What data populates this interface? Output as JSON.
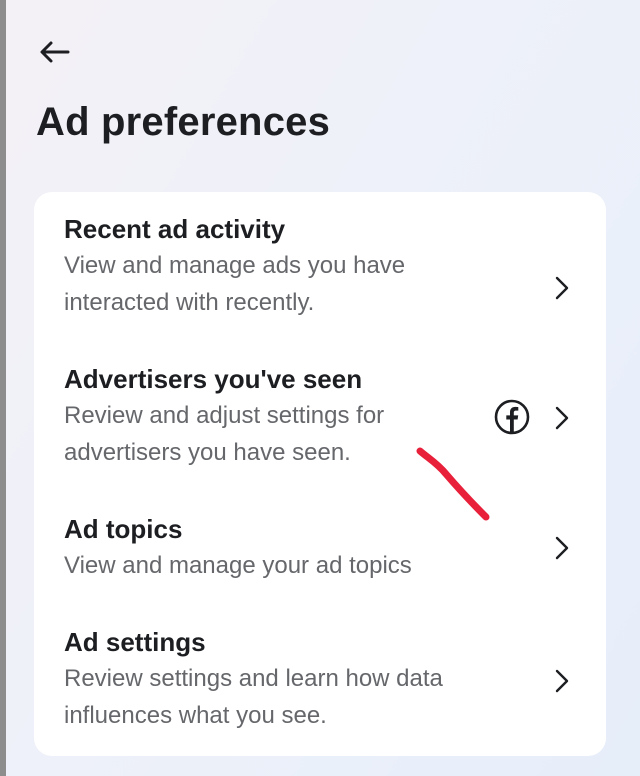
{
  "header": {
    "back_icon": "arrow-left-icon",
    "title": "Ad preferences"
  },
  "menu": {
    "items": [
      {
        "title": "Recent ad activity",
        "description": "View and manage ads you have interacted with recently.",
        "trailing_icon": "chevron-right-icon"
      },
      {
        "title": "Advertisers you've seen",
        "description": "Review and adjust settings for advertisers you have seen.",
        "extra_icon": "facebook-icon",
        "trailing_icon": "chevron-right-icon"
      },
      {
        "title": "Ad topics",
        "description": "View and manage your ad topics",
        "trailing_icon": "chevron-right-icon"
      },
      {
        "title": "Ad settings",
        "description": "Review settings and learn how data influences what you see.",
        "trailing_icon": "chevron-right-icon"
      }
    ]
  },
  "colors": {
    "title_text": "#1c1e21",
    "secondary_text": "#65676b",
    "card_background": "#ffffff",
    "annotation_mark": "#e8203a"
  }
}
